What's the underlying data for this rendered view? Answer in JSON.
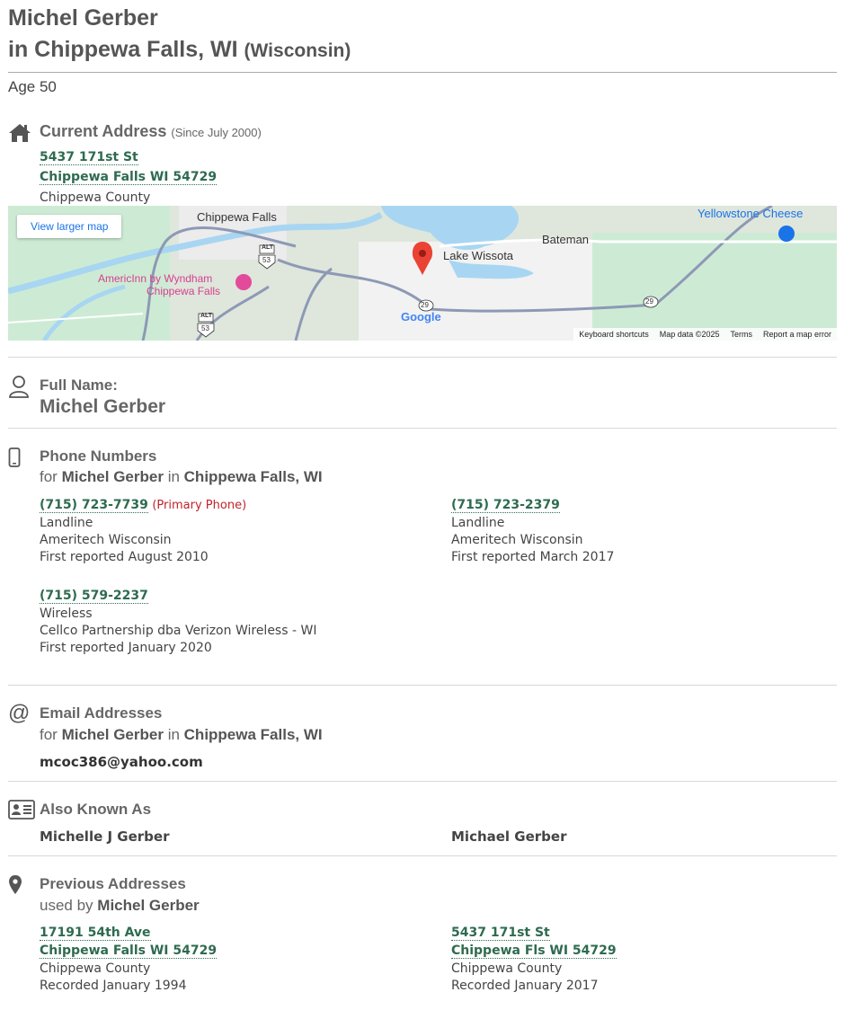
{
  "header": {
    "name": "Michel Gerber",
    "location_prefix": "in Chippewa Falls, WI",
    "state": "(Wisconsin)"
  },
  "age": "Age 50",
  "current_address": {
    "title": "Current Address",
    "since": "(Since July 2000)",
    "street": "5437 171st St",
    "city_line": "Chippewa Falls WI 54729",
    "county": "Chippewa County"
  },
  "map": {
    "view_larger": "View larger map",
    "labels": {
      "chippewa_falls": "Chippewa Falls",
      "lake_wissota": "Lake Wissota",
      "bateman": "Bateman",
      "yellowstone": "Yellowstone Cheese",
      "americinn_1": "AmericInn by Wyndham",
      "americinn_2": "Chippewa Falls",
      "alt": "ALT",
      "r53": "53",
      "r29": "29",
      "google": "Google"
    },
    "footer": {
      "shortcuts": "Keyboard shortcuts",
      "data": "Map data ©2025",
      "terms": "Terms",
      "report": "Report a map error"
    }
  },
  "full_name": {
    "title": "Full Name:",
    "value": "Michel Gerber"
  },
  "phones": {
    "title": "Phone Numbers",
    "sub_for": "for",
    "sub_name": "Michel Gerber",
    "sub_in": "in",
    "sub_place": "Chippewa Falls, WI",
    "primary_label": "(Primary Phone)",
    "items": [
      {
        "number": "(715) 723-7739",
        "type": "Landline",
        "carrier": "Ameritech Wisconsin",
        "reported": "First reported August 2010"
      },
      {
        "number": "(715) 723-2379",
        "type": "Landline",
        "carrier": "Ameritech Wisconsin",
        "reported": "First reported March 2017"
      },
      {
        "number": "(715) 579-2237",
        "type": "Wireless",
        "carrier": "Cellco Partnership dba Verizon Wireless - WI",
        "reported": "First reported January 2020"
      }
    ]
  },
  "emails": {
    "title": "Email Addresses",
    "sub_for": "for",
    "sub_name": "Michel Gerber",
    "sub_in": "in",
    "sub_place": "Chippewa Falls, WI",
    "items": [
      "mcoc386@yahoo.com"
    ]
  },
  "aka": {
    "title": "Also Known As",
    "items": [
      "Michelle J Gerber",
      "Michael Gerber"
    ]
  },
  "previous": {
    "title": "Previous Addresses",
    "sub_used": "used by",
    "sub_name": "Michel Gerber",
    "items": [
      {
        "street": "17191 54th Ave",
        "city_line": "Chippewa Falls WI 54729",
        "county": "Chippewa County",
        "recorded": "Recorded January 1994"
      },
      {
        "street": "5437 171st St",
        "city_line": "Chippewa Fls WI 54729",
        "county": "Chippewa County",
        "recorded": "Recorded January 2017"
      }
    ]
  },
  "colors": {
    "link": "#2e6b4f",
    "primary_phone": "#c0232b",
    "heading": "#666666"
  }
}
